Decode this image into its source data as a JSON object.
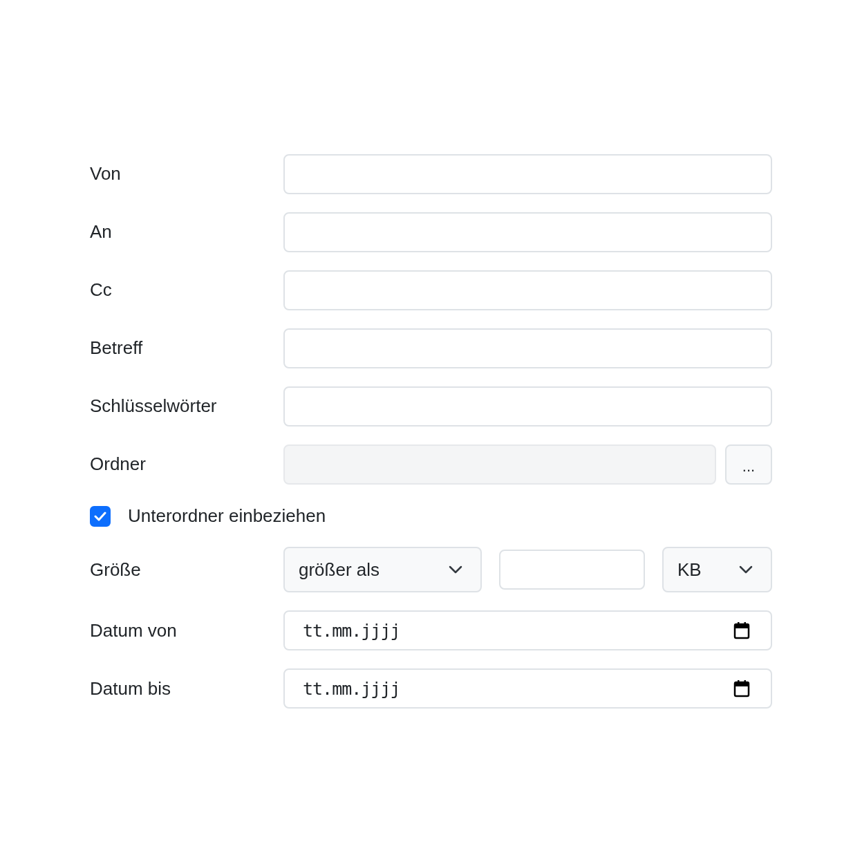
{
  "fields": [
    {
      "label": "Von",
      "kind": "text"
    },
    {
      "label": "An",
      "kind": "text"
    },
    {
      "label": "Cc",
      "kind": "text"
    },
    {
      "label": "Betreff",
      "kind": "text"
    },
    {
      "label": "Schlüsselwörter",
      "kind": "text"
    },
    {
      "label": "Ordner",
      "kind": "folder",
      "button": "..."
    }
  ],
  "include_subfolders": {
    "label": "Unterordner einbeziehen",
    "checked": true
  },
  "size": {
    "label": "Größe",
    "comparison": "größer als",
    "unit": "KB"
  },
  "dates": [
    {
      "label": "Datum von",
      "value": "tt.mm.jjjj"
    },
    {
      "label": "Datum bis",
      "value": "tt.mm.jjjj"
    }
  ]
}
